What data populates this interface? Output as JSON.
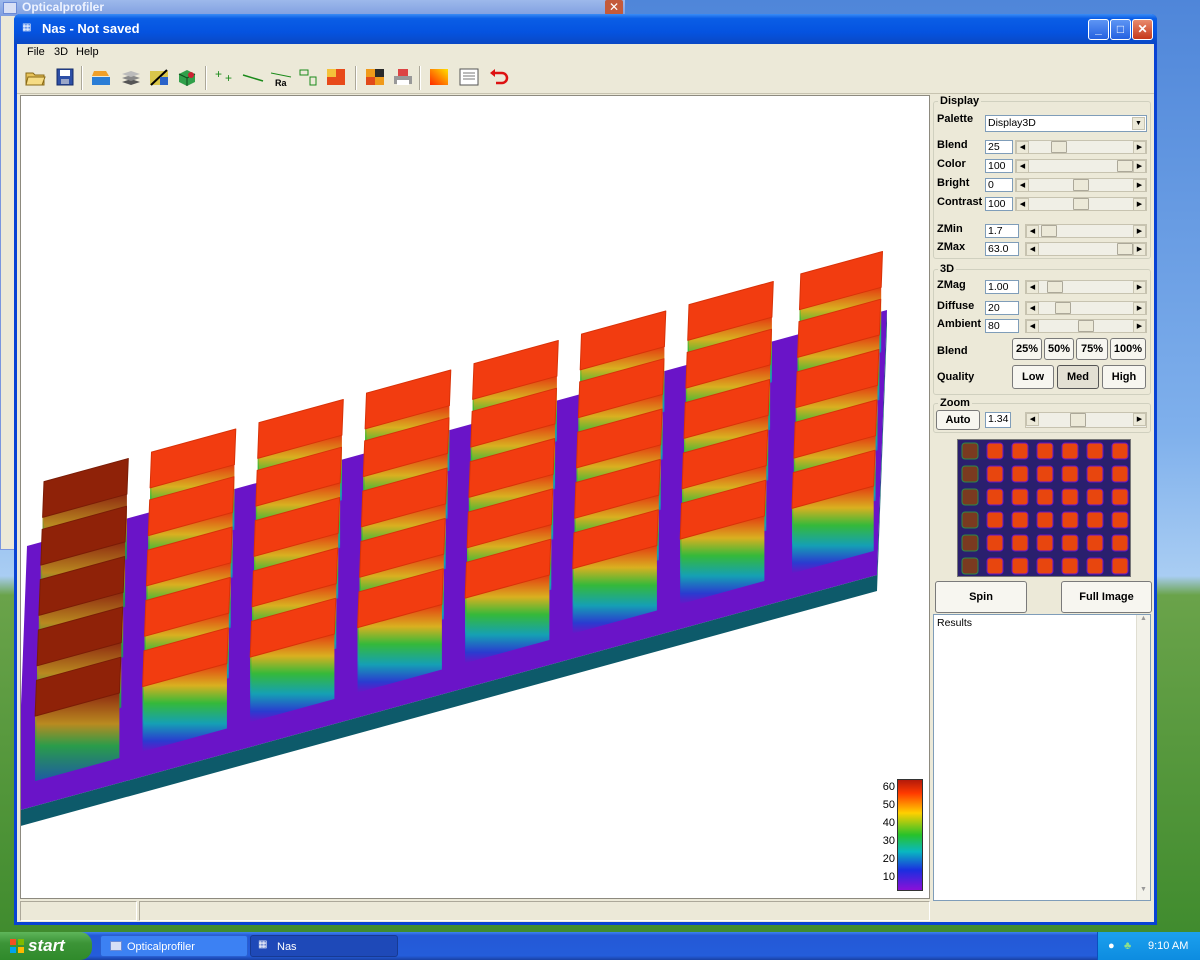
{
  "background_window": {
    "title": "Opticalprofiler"
  },
  "window": {
    "title": "Nas - Not saved"
  },
  "menu": [
    "File",
    "3D",
    "Help"
  ],
  "display": {
    "legend": "Display",
    "palette_label": "Palette",
    "palette_value": "Display3D",
    "blend_label": "Blend",
    "blend_value": "25",
    "blend_level": 0.25,
    "color_label": "Color",
    "color_value": "100",
    "color_level": 1.0,
    "bright_label": "Bright",
    "bright_value": "0",
    "bright_level": 0.5,
    "contrast_label": "Contrast",
    "contrast_value": "100",
    "contrast_level": 0.5,
    "zmin_label": "ZMin",
    "zmin_value": "1.7",
    "zmin_level": 0.03,
    "zmax_label": "ZMax",
    "zmax_value": "63.0",
    "zmax_level": 1.0
  },
  "three_d": {
    "legend": "3D",
    "zmag_label": "ZMag",
    "zmag_value": "1.00",
    "zmag_level": 0.1,
    "diffuse_label": "Diffuse",
    "diffuse_value": "20",
    "diffuse_level": 0.2,
    "ambient_label": "Ambient",
    "ambient_value": "80",
    "ambient_level": 0.5,
    "blend_label": "Blend",
    "blend_buttons": [
      "25%",
      "50%",
      "75%",
      "100%"
    ],
    "quality_label": "Quality",
    "quality_buttons": [
      "Low",
      "Med",
      "High"
    ],
    "quality_selected": "Med"
  },
  "zoom": {
    "legend": "Zoom",
    "auto_label": "Auto",
    "value": "1.34",
    "level": 0.4
  },
  "spin_label": "Spin",
  "full_image_label": "Full Image",
  "results_label": "Results",
  "colorbar": {
    "ticks": [
      "60",
      "50",
      "40",
      "30",
      "20",
      "10"
    ]
  },
  "taskbar": {
    "start_label": "start",
    "tasks": [
      "Opticalprofiler",
      "Nas"
    ],
    "clock": "9:10 AM"
  },
  "icons": [
    "open-folder-icon",
    "save-icon",
    "layer-icon",
    "stack-icon",
    "wand-icon",
    "cube-icon",
    "points-icon",
    "line-icon",
    "roughness-icon",
    "step-icon",
    "region-icon",
    "split-icon",
    "print-icon",
    "palette-icon",
    "report-icon",
    "undo-icon"
  ],
  "colors": {
    "accent": "#0553e0",
    "plateau": "#f23c10",
    "base": "#6a14c8"
  }
}
